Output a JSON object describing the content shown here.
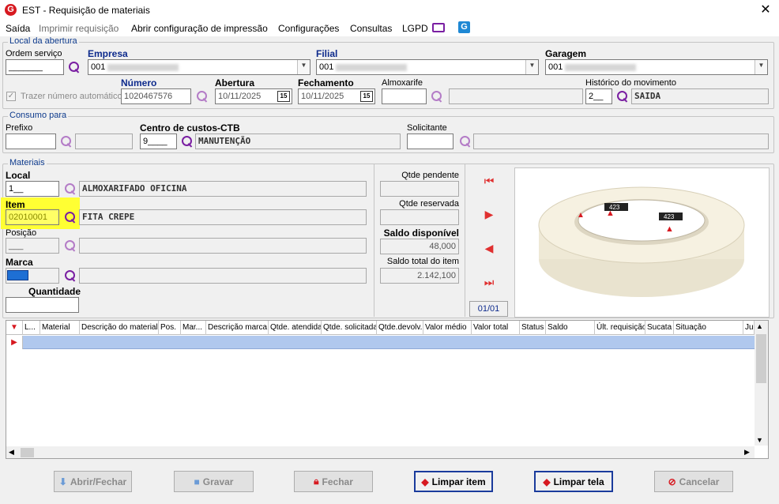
{
  "window": {
    "title": "EST - Requisição de materiais",
    "app_icon": "G"
  },
  "menu": {
    "saida": "Saída",
    "imprimir": "Imprimir requisição",
    "abrir_config": "Abrir configuração de impressão",
    "configuracoes": "Configurações",
    "consultas": "Consultas",
    "lgpd": "LGPD"
  },
  "local_abertura": {
    "legend": "Local da abertura",
    "ordem_servico_label": "Ordem serviço",
    "ordem_servico_value": "_______",
    "empresa_label": "Empresa",
    "empresa_value": "001",
    "filial_label": "Filial",
    "filial_value": "001",
    "garagem_label": "Garagem",
    "garagem_value": "001",
    "trazer_numero_label": "Trazer número automático",
    "numero_label": "Número",
    "numero_value": "1020467576",
    "abertura_label": "Abertura",
    "abertura_value": "10/11/2025",
    "fechamento_label": "Fechamento",
    "fechamento_value": "10/11/2025",
    "almoxarife_label": "Almoxarife",
    "almoxarife_value": "",
    "historico_label": "Histórico do movimento",
    "historico_code": "2__",
    "historico_desc": "SAIDA",
    "cal_icon": "15"
  },
  "consumo_para": {
    "legend": "Consumo para",
    "prefixo_label": "Prefixo",
    "prefixo_value": "",
    "centro_label": "Centro de custos-CTB",
    "centro_code": "9____",
    "centro_desc": "MANUTENÇÃO",
    "solicitante_label": "Solicitante",
    "solicitante_value": ""
  },
  "materiais": {
    "legend": "Materiais",
    "local_label": "Local",
    "local_code": "1__",
    "local_desc": "ALMOXARIFADO OFICINA",
    "item_label": "Item",
    "item_code": "02010001",
    "item_desc": "FITA CREPE",
    "posicao_label": "Posição",
    "posicao_value": "___",
    "marca_label": "Marca",
    "quantidade_label": "Quantidade",
    "quantidade_value": "",
    "qtde_pendente_label": "Qtde pendente",
    "qtde_pendente_value": "",
    "qtde_reservada_label": "Qtde reservada",
    "qtde_reservada_value": "",
    "saldo_disponivel_label": "Saldo disponível",
    "saldo_disponivel_value": "48,000",
    "saldo_total_label": "Saldo total do item",
    "saldo_total_value": "2.142,100",
    "page_indicator": "01/01",
    "tape_brand": "423"
  },
  "grid": {
    "columns": [
      "L...",
      "Material",
      "Descrição do material",
      "Pos.",
      "Mar...",
      "Descrição marca",
      "Qtde. atendida",
      "Qtde. solicitada",
      "Qtde.devolv.",
      "Valor médio",
      "Valor total",
      "Status",
      "Saldo",
      "Últ. requisição",
      "Sucata",
      "Situação",
      "Ju"
    ]
  },
  "buttons": {
    "abrir_fechar": "Abrir/Fechar",
    "gravar": "Gravar",
    "fechar": "Fechar",
    "limpar_item": "Limpar item",
    "limpar_tela": "Limpar tela",
    "cancelar": "Cancelar"
  },
  "colors": {
    "highlight": "#ffff33",
    "accent": "#1a3b9c",
    "nav_red": "#e03030",
    "magnifier": "#7a1fa2"
  }
}
